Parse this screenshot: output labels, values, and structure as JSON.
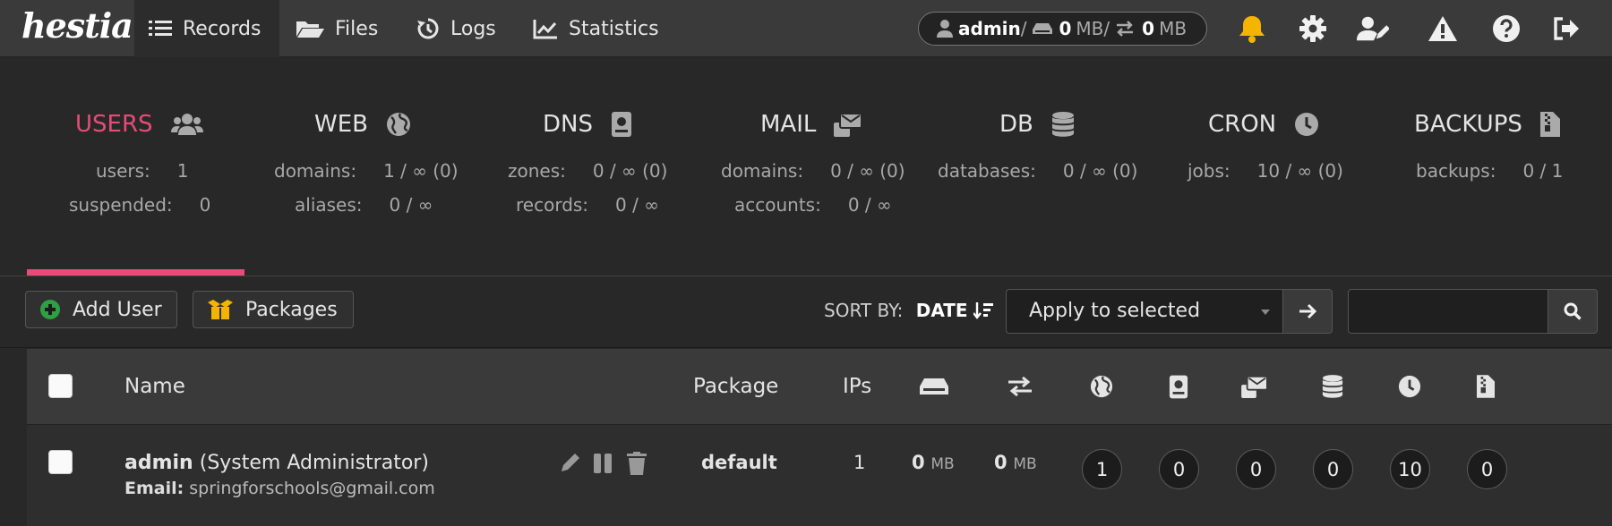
{
  "brand": "hestia",
  "nav": {
    "records": "Records",
    "files": "Files",
    "logs": "Logs",
    "statistics": "Statistics"
  },
  "quota": {
    "user": "admin",
    "sep1": " / ",
    "disk_value": "0",
    "disk_unit": "MB",
    "sep2": " / ",
    "bw_value": "0",
    "bw_unit": "MB"
  },
  "colors": {
    "accent": "#e54c7a",
    "bell": "#f5b400",
    "add_icon": "#2ea043",
    "packages_icon": "#f5b400"
  },
  "overview": {
    "users": {
      "title": "USERS",
      "l1_label": "users:",
      "l1_value": "1",
      "l2_label": "suspended:",
      "l2_value": "0"
    },
    "web": {
      "title": "WEB",
      "l1_label": "domains:",
      "l1_value": "1 / ∞ (0)",
      "l2_label": "aliases:",
      "l2_value": "0 / ∞"
    },
    "dns": {
      "title": "DNS",
      "l1_label": "zones:",
      "l1_value": "0 / ∞ (0)",
      "l2_label": "records:",
      "l2_value": "0 / ∞"
    },
    "mail": {
      "title": "MAIL",
      "l1_label": "domains:",
      "l1_value": "0 / ∞ (0)",
      "l2_label": "accounts:",
      "l2_value": "0 / ∞"
    },
    "db": {
      "title": "DB",
      "l1_label": "databases:",
      "l1_value": "0 / ∞ (0)"
    },
    "cron": {
      "title": "CRON",
      "l1_label": "jobs:",
      "l1_value": "10 / ∞ (0)"
    },
    "backups": {
      "title": "BACKUPS",
      "l1_label": "backups:",
      "l1_value": "0 / 1"
    }
  },
  "toolbar": {
    "add_user": "Add User",
    "packages": "Packages",
    "sort_by_label": "SORT BY:",
    "sort_by_value": "DATE",
    "bulk_action": "Apply to selected",
    "search_value": ""
  },
  "table": {
    "headers": {
      "name": "Name",
      "package": "Package",
      "ips": "IPs"
    },
    "rows": [
      {
        "username": "admin",
        "fullname": "(System Administrator)",
        "email_label": "Email:",
        "email": "springforschools@gmail.com",
        "package": "default",
        "ips": "1",
        "disk_value": "0",
        "disk_unit": "MB",
        "bw_value": "0",
        "bw_unit": "MB",
        "web": "1",
        "dns": "0",
        "mail": "0",
        "db": "0",
        "cron": "10",
        "backups": "0"
      }
    ]
  }
}
